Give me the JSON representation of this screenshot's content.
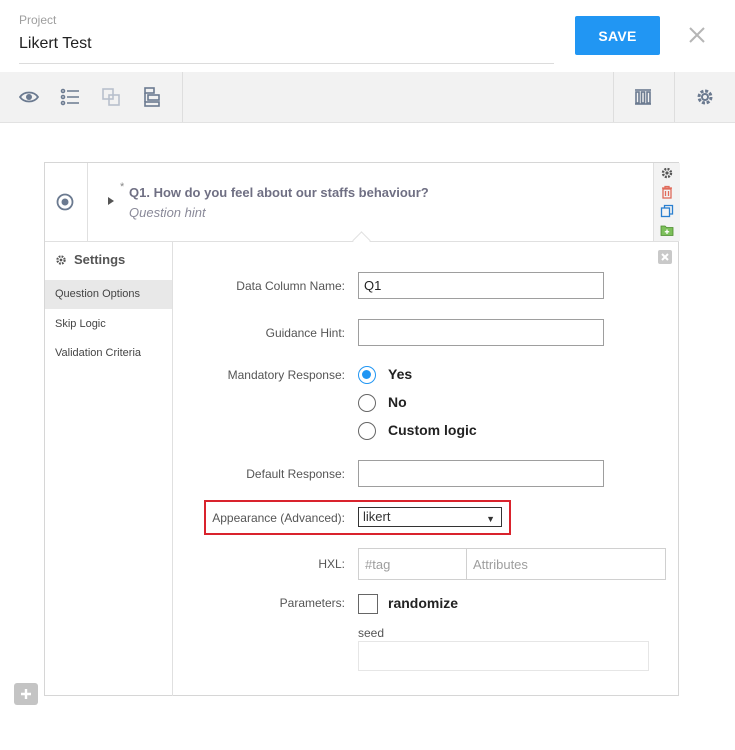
{
  "header": {
    "project_label": "Project",
    "project_name": "Likert Test",
    "save_label": "SAVE"
  },
  "toolbar": {
    "icons": [
      "eye-icon",
      "list-icon",
      "layers-icon",
      "group-icon",
      "library-icon",
      "gear-icon"
    ]
  },
  "question": {
    "required_marker": "*",
    "label": "Q1. How do you feel about our staffs behaviour?",
    "hint": "Question hint"
  },
  "settings": {
    "title": "Settings",
    "tabs": [
      "Question Options",
      "Skip Logic",
      "Validation Criteria"
    ],
    "active_tab": "Question Options"
  },
  "form": {
    "data_column_label": "Data Column Name:",
    "data_column_value": "Q1",
    "guidance_label": "Guidance Hint:",
    "guidance_value": "",
    "mandatory_label": "Mandatory Response:",
    "mandatory_options": [
      "Yes",
      "No",
      "Custom logic"
    ],
    "mandatory_selected": "Yes",
    "default_label": "Default Response:",
    "default_value": "",
    "appearance_label": "Appearance (Advanced):",
    "appearance_value": "likert",
    "hxl_label": "HXL:",
    "hxl_tag_placeholder": "#tag",
    "hxl_attr_placeholder": "Attributes",
    "parameters_label": "Parameters:",
    "randomize_label": "randomize",
    "seed_label": "seed"
  },
  "colors": {
    "primary": "#2196f3",
    "highlight_border": "#d9232d"
  }
}
